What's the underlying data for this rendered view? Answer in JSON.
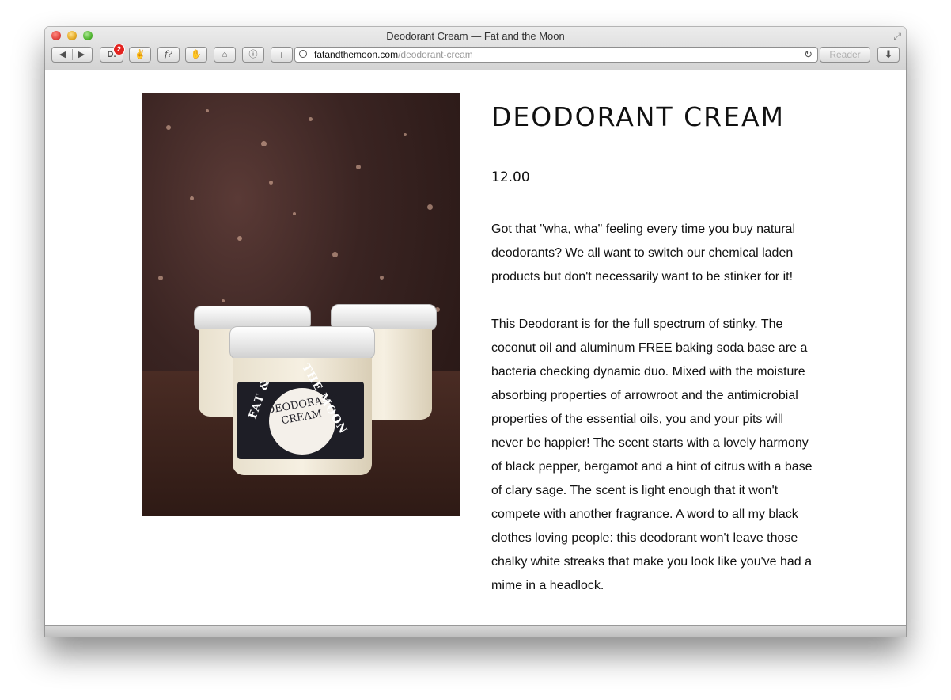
{
  "window": {
    "title": "Deodorant Cream — Fat and the Moon"
  },
  "toolbar": {
    "back": "◀",
    "forward": "▶",
    "ext1": "D.",
    "ext1_badge": "2",
    "ext2": "✌",
    "ext3": "f?",
    "ext4": "✋",
    "ext5": "⌂",
    "ext6": "ⓘ",
    "add": "+",
    "reader_label": "Reader",
    "download": "⬇"
  },
  "address": {
    "domain": "fatandthemoon.com",
    "path": "/deodorant-cream",
    "reload": "↻"
  },
  "product": {
    "title": "DEODORANT CREAM",
    "price": "12.00",
    "description_1": "Got that \"wha, wha\" feeling every time you buy natural deodorants? We all want to switch our chemical laden products but don't necessarily want to be stinker for it!",
    "description_2": "This Deodorant is for the full spectrum of stinky. The coconut oil and aluminum FREE baking soda base are a bacteria checking dynamic duo. Mixed with the moisture absorbing properties of arrowroot and the antimicrobial properties of the essential oils, you and your pits will never be happier! The scent starts with a lovely harmony of black pepper, bergamot and a hint of citrus with a base of clary sage. The scent is light enough that it won't compete with another fragrance. A word to all my black clothes loving people: this deodorant won't leave those chalky white streaks that make you look like you've had a mime in a headlock.",
    "jar_label_left": "FAT &",
    "jar_label_center": "DEODORANT CREAM",
    "jar_label_right": "THE MOON"
  }
}
